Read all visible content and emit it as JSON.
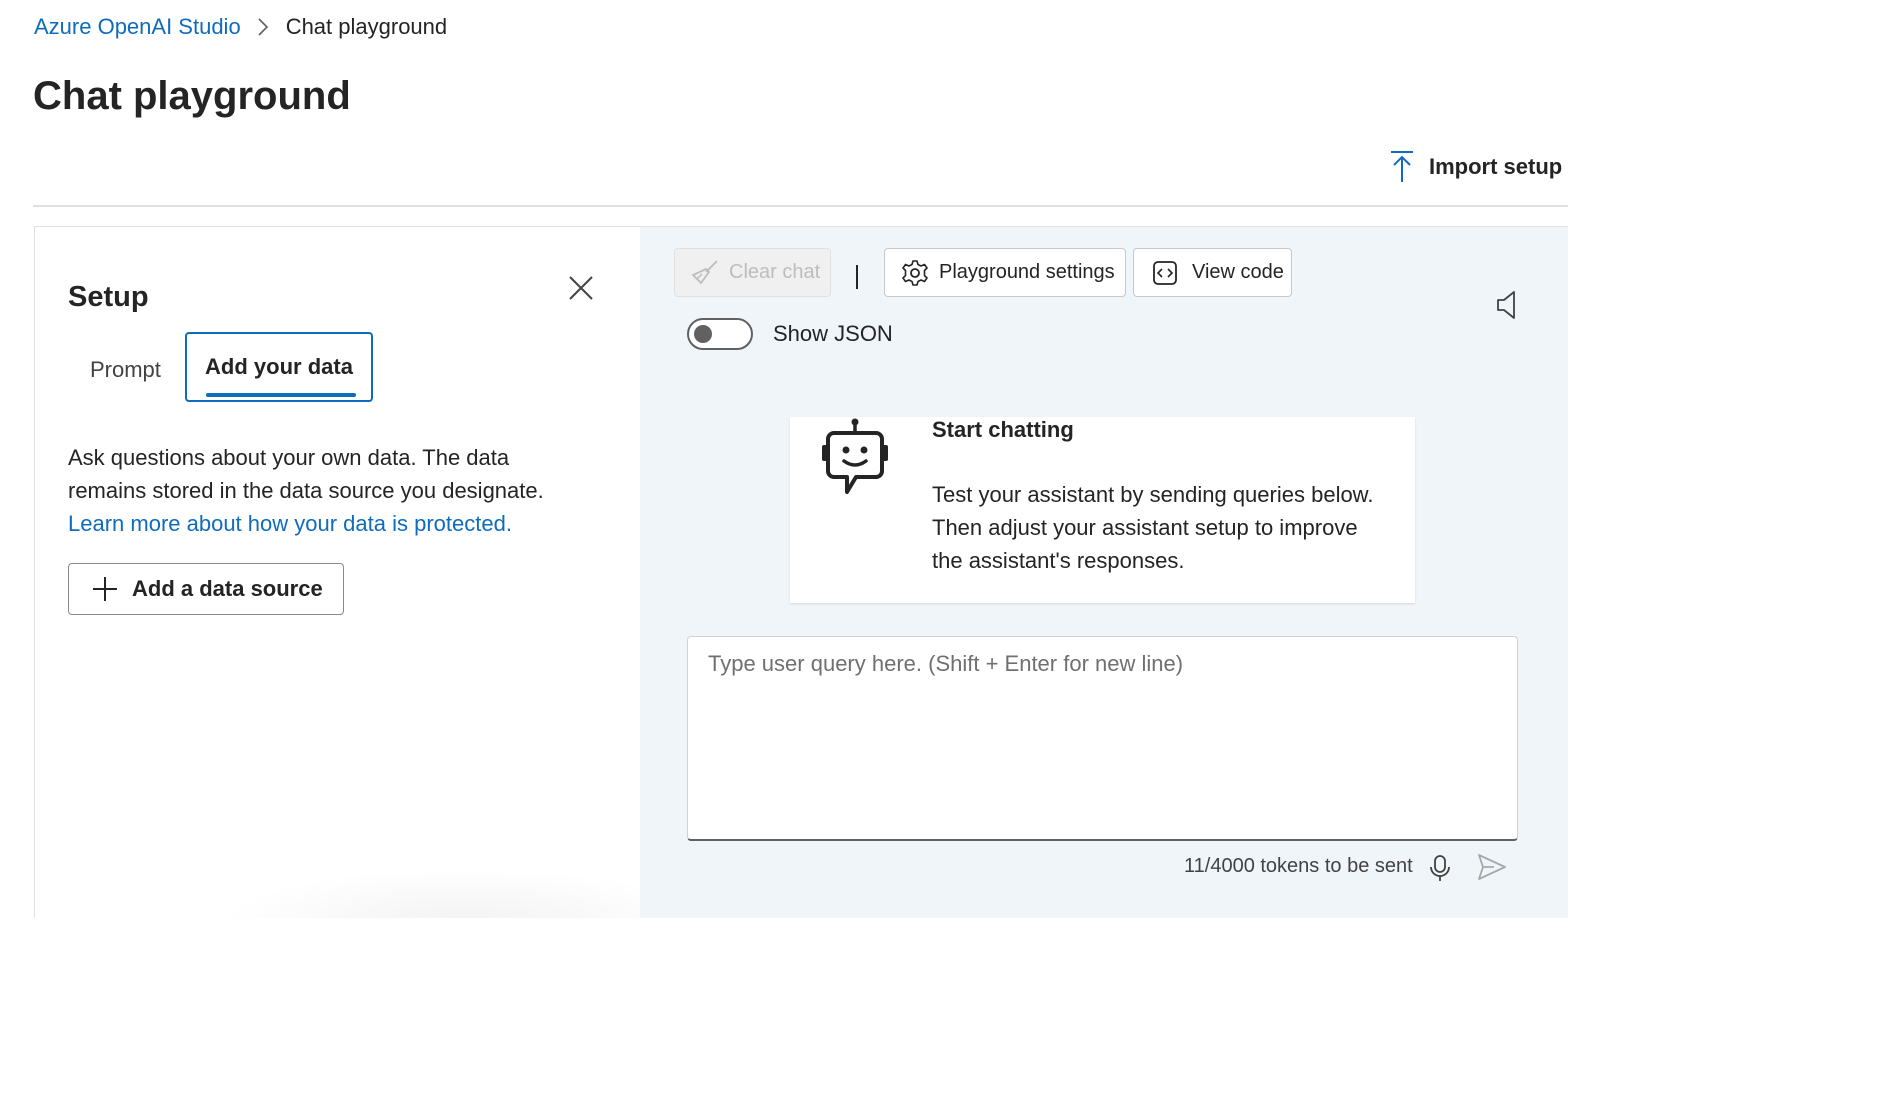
{
  "breadcrumb": {
    "root": "Azure OpenAI Studio",
    "current": "Chat playground"
  },
  "page": {
    "title": "Chat playground",
    "import_setup_label": "Import setup"
  },
  "setup": {
    "title": "Setup",
    "tabs": [
      {
        "label": "Prompt",
        "selected": false
      },
      {
        "label": "Add your data",
        "selected": true
      }
    ],
    "description": "Ask questions about your own data. The data remains stored in the data source you designate.",
    "learn_more_link": "Learn more about how your data is protected.",
    "add_source_label": "Add a data source"
  },
  "chat": {
    "toolbar": {
      "clear_chat_label": "Clear chat",
      "clear_chat_disabled": true,
      "playground_settings_label": "Playground settings",
      "view_code_label": "View code"
    },
    "show_json": {
      "label": "Show JSON",
      "enabled": false
    },
    "start_card": {
      "title": "Start chatting",
      "body": "Test your assistant by sending queries below. Then adjust your assistant setup to improve the assistant's responses."
    },
    "input": {
      "placeholder": "Type user query here. (Shift + Enter for new line)",
      "value": ""
    },
    "token_count": "11/4000 tokens to be sent"
  },
  "colors": {
    "accent": "#0f6cbd",
    "chat_background": "#f0f5fa",
    "text": "#242424"
  }
}
